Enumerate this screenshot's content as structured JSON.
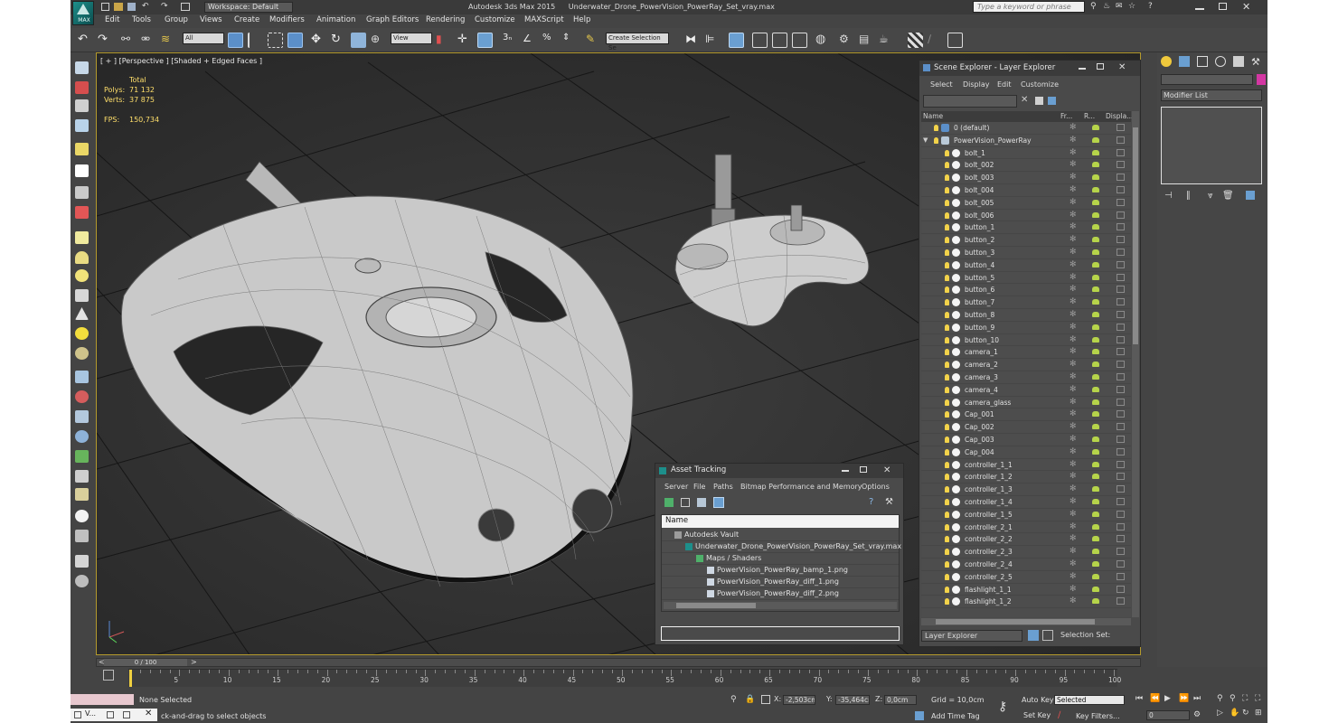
{
  "app": {
    "logo_text": "MAX",
    "workspace": "Workspace: Default",
    "app_name": "Autodesk 3ds Max  2015",
    "file_name": "Underwater_Drone_PowerVision_PowerRay_Set_vray.max",
    "search_placeholder": "Type a keyword or phrase"
  },
  "menu": [
    "Edit",
    "Tools",
    "Group",
    "Views",
    "Create",
    "Modifiers",
    "Animation",
    "Graph Editors",
    "Rendering",
    "Customize",
    "MAXScript",
    "Help"
  ],
  "toolbar": {
    "filter_value": "All",
    "view_value": "View",
    "selection_set_value": "Create Selection Se"
  },
  "viewport": {
    "label": "[ + ] [Perspective ] [Shaded + Edged Faces ]",
    "stats_total": "Total",
    "polys_label": "Polys:",
    "polys_value": "71 132",
    "verts_label": "Verts:",
    "verts_value": "37 875",
    "fps_label": "FPS:",
    "fps_value": "150,734"
  },
  "scene_explorer": {
    "title": "Scene Explorer - Layer Explorer",
    "menu": [
      "Select",
      "Display",
      "Edit",
      "Customize"
    ],
    "columns": [
      "Name",
      "Fr...",
      "R...",
      "Displa..."
    ],
    "rows": [
      {
        "name": "0 (default)",
        "level": 0
      },
      {
        "name": "PowerVision_PowerRay",
        "level": 0
      },
      {
        "name": "bolt_1",
        "level": 1
      },
      {
        "name": "bolt_002",
        "level": 1
      },
      {
        "name": "bolt_003",
        "level": 1
      },
      {
        "name": "bolt_004",
        "level": 1
      },
      {
        "name": "bolt_005",
        "level": 1
      },
      {
        "name": "bolt_006",
        "level": 1
      },
      {
        "name": "button_1",
        "level": 1
      },
      {
        "name": "button_2",
        "level": 1
      },
      {
        "name": "button_3",
        "level": 1
      },
      {
        "name": "button_4",
        "level": 1
      },
      {
        "name": "button_5",
        "level": 1
      },
      {
        "name": "button_6",
        "level": 1
      },
      {
        "name": "button_7",
        "level": 1
      },
      {
        "name": "button_8",
        "level": 1
      },
      {
        "name": "button_9",
        "level": 1
      },
      {
        "name": "button_10",
        "level": 1
      },
      {
        "name": "camera_1",
        "level": 1
      },
      {
        "name": "camera_2",
        "level": 1
      },
      {
        "name": "camera_3",
        "level": 1
      },
      {
        "name": "camera_4",
        "level": 1
      },
      {
        "name": "camera_glass",
        "level": 1
      },
      {
        "name": "Cap_001",
        "level": 1
      },
      {
        "name": "Cap_002",
        "level": 1
      },
      {
        "name": "Cap_003",
        "level": 1
      },
      {
        "name": "Cap_004",
        "level": 1
      },
      {
        "name": "controller_1_1",
        "level": 1
      },
      {
        "name": "controller_1_2",
        "level": 1
      },
      {
        "name": "controller_1_3",
        "level": 1
      },
      {
        "name": "controller_1_4",
        "level": 1
      },
      {
        "name": "controller_1_5",
        "level": 1
      },
      {
        "name": "controller_2_1",
        "level": 1
      },
      {
        "name": "controller_2_2",
        "level": 1
      },
      {
        "name": "controller_2_3",
        "level": 1
      },
      {
        "name": "controller_2_4",
        "level": 1
      },
      {
        "name": "controller_2_5",
        "level": 1
      },
      {
        "name": "flashlight_1_1",
        "level": 1
      },
      {
        "name": "flashlight_1_2",
        "level": 1
      }
    ],
    "footer_mode": "Layer Explorer",
    "footer_label": "Selection Set:"
  },
  "asset_tracking": {
    "title": "Asset Tracking",
    "menu": [
      "Server",
      "File",
      "Paths",
      "Bitmap Performance and Memory",
      "Options"
    ],
    "column": "Name",
    "rows": [
      {
        "label": "Autodesk Vault",
        "level": 0
      },
      {
        "label": "Underwater_Drone_PowerVision_PowerRay_Set_vray.max",
        "level": 1
      },
      {
        "label": "Maps / Shaders",
        "level": 2
      },
      {
        "label": "PowerVision_PowerRay_bamp_1.png",
        "level": 3
      },
      {
        "label": "PowerVision_PowerRay_diff_1.png",
        "level": 3
      },
      {
        "label": "PowerVision_PowerRay_diff_2.png",
        "level": 3
      }
    ]
  },
  "command_panel": {
    "modifier_list": "Modifier List"
  },
  "timeline": {
    "frame_counter": "0 / 100",
    "ticks": [
      "5",
      "10",
      "15",
      "20",
      "25",
      "30",
      "35",
      "40",
      "45",
      "50",
      "55",
      "60",
      "65",
      "70",
      "75",
      "80",
      "85",
      "90",
      "95",
      "100"
    ]
  },
  "status": {
    "selection": "None Selected",
    "prompt": "ck-and-drag to select objects",
    "x_label": "X:",
    "x_value": "-2,503cm",
    "y_label": "Y:",
    "y_value": "-35,464cm",
    "z_label": "Z:",
    "z_value": "0,0cm",
    "grid": "Grid = 10,0cm",
    "add_time_tag": "Add Time Tag",
    "auto_key": "Auto Key",
    "auto_key_value": "Selected",
    "set_key": "Set Key",
    "key_filters": "Key Filters...",
    "frame_value": "0",
    "taskbar_item": "V..."
  }
}
